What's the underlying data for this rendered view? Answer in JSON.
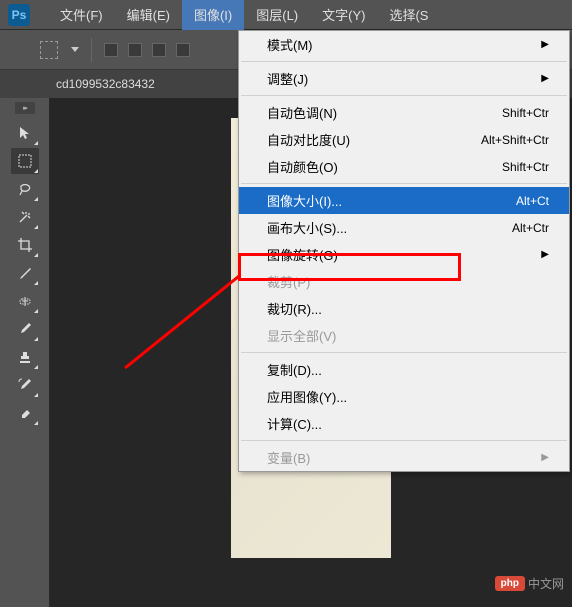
{
  "logo": "Ps",
  "menubar": {
    "file": "文件(F)",
    "edit": "编辑(E)",
    "image": "图像(I)",
    "layer": "图层(L)",
    "text": "文字(Y)",
    "select": "选择(S"
  },
  "tab": {
    "title": "cd1099532c83432"
  },
  "dropdown": {
    "mode": "模式(M)",
    "adjust": "调整(J)",
    "autoTone": {
      "label": "自动色调(N)",
      "shortcut": "Shift+Ctr"
    },
    "autoContrast": {
      "label": "自动对比度(U)",
      "shortcut": "Alt+Shift+Ctr"
    },
    "autoColor": {
      "label": "自动颜色(O)",
      "shortcut": "Shift+Ctr"
    },
    "imageSize": {
      "label": "图像大小(I)...",
      "shortcut": "Alt+Ct"
    },
    "canvasSize": {
      "label": "画布大小(S)...",
      "shortcut": "Alt+Ctr"
    },
    "rotate": "图像旋转(G)",
    "crop": "裁剪(P)",
    "trim": "裁切(R)...",
    "revealAll": "显示全部(V)",
    "duplicate": "复制(D)...",
    "applyImage": "应用图像(Y)...",
    "calculations": "计算(C)...",
    "variables": "变量(B)"
  },
  "watermark": {
    "badge": "php",
    "text": "中文网"
  }
}
